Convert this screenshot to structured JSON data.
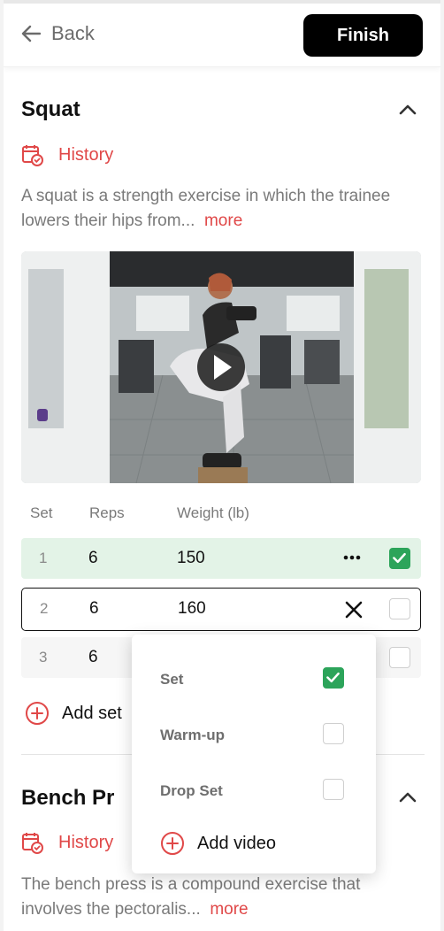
{
  "header": {
    "back_label": "Back",
    "finish_label": "Finish"
  },
  "exercises": [
    {
      "name": "Squat",
      "history_label": "History",
      "description": "A squat is a strength exercise in which the trainee lowers their hips from...",
      "more_label": "more"
    },
    {
      "name": "Bench Pr",
      "history_label": "History",
      "description": "The bench press is a compound exercise that involves the pectoralis...",
      "more_label": "more"
    }
  ],
  "sets_table": {
    "headers": {
      "set": "Set",
      "reps": "Reps",
      "weight": "Weight (lb)"
    },
    "rows": [
      {
        "set": "1",
        "reps": "6",
        "weight": "150",
        "completed": true
      },
      {
        "set": "2",
        "reps": "6",
        "weight": "160",
        "completed": false
      },
      {
        "set": "3",
        "reps": "6",
        "weight": "",
        "completed": false
      }
    ],
    "add_set_label": "Add set"
  },
  "set_type_menu": {
    "options": [
      {
        "label": "Set",
        "checked": true
      },
      {
        "label": "Warm-up",
        "checked": false
      },
      {
        "label": "Drop Set",
        "checked": false
      }
    ],
    "add_video_label": "Add video"
  },
  "colors": {
    "accent_red": "#e04848",
    "completed_green": "#2ca45a",
    "completed_row_bg": "#e3f3e7",
    "primary_button": "#000000"
  }
}
